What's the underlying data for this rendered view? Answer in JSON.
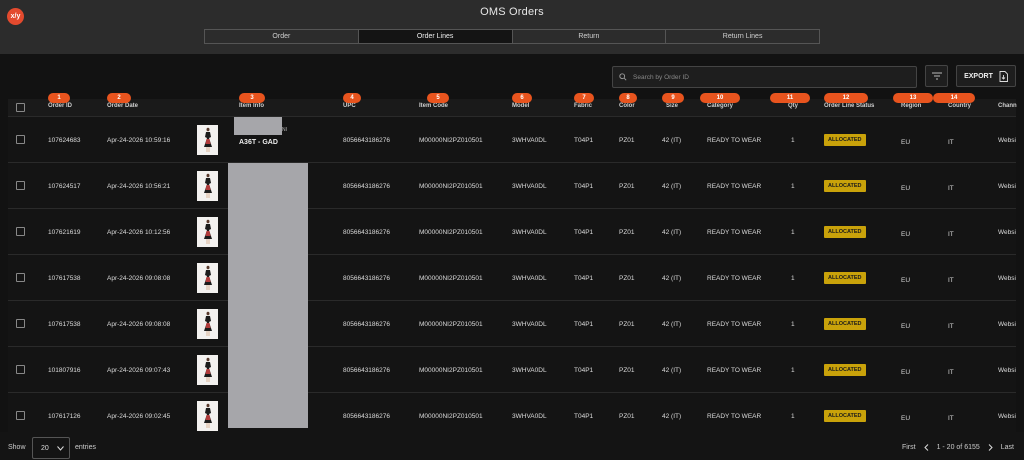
{
  "app": {
    "logo_text": "x/y",
    "title": "OMS Orders"
  },
  "tabs": [
    {
      "label": "Order",
      "active": false
    },
    {
      "label": "Order Lines",
      "active": true
    },
    {
      "label": "Return",
      "active": false
    },
    {
      "label": "Return Lines",
      "active": false
    }
  ],
  "toolbar": {
    "search_placeholder": "Search by Order ID",
    "search_icon": "search-icon",
    "filter_icon": "filter-icon",
    "export_label": "EXPORT",
    "export_icon": "file-export-icon"
  },
  "table": {
    "columns": [
      {
        "label": "Order ID",
        "marker": "1"
      },
      {
        "label": "Order Date",
        "marker": "2"
      },
      {
        "label": "Item Info",
        "marker": "3"
      },
      {
        "label": "UPC",
        "marker": "4"
      },
      {
        "label": "Item Code",
        "marker": "5"
      },
      {
        "label": "Model",
        "marker": "6"
      },
      {
        "label": "Fabric",
        "marker": "7"
      },
      {
        "label": "Color",
        "marker": "8"
      },
      {
        "label": "Size",
        "marker": "9"
      },
      {
        "label": "Category",
        "marker": "10"
      },
      {
        "label": "Qty",
        "marker": "11"
      },
      {
        "label": "Order Line Status",
        "marker": "12"
      },
      {
        "label": "Region",
        "marker": "13"
      },
      {
        "label": "Country",
        "marker": "14"
      },
      {
        "label": "Chann",
        "marker": ""
      }
    ],
    "first_row_item": {
      "tail": "NI",
      "label": "A36T - GAD"
    },
    "rows": [
      {
        "order_id": "107624683",
        "order_date": "Apr-24-2026 10:59:16",
        "upc": "8056643186276",
        "item_code": "M00000NI2PZ010501",
        "model": "3WHVA0DL",
        "fabric": "T04P1",
        "color": "PZ01",
        "size": "42 (IT)",
        "category": "READY TO WEAR",
        "qty": "1",
        "status": "ALLOCATED",
        "region": "EU",
        "country": "IT",
        "channel": "Websi"
      },
      {
        "order_id": "107624517",
        "order_date": "Apr-24-2026 10:56:21",
        "upc": "8056643186276",
        "item_code": "M00000NI2PZ010501",
        "model": "3WHVA0DL",
        "fabric": "T04P1",
        "color": "PZ01",
        "size": "42 (IT)",
        "category": "READY TO WEAR",
        "qty": "1",
        "status": "ALLOCATED",
        "region": "EU",
        "country": "IT",
        "channel": "Websi"
      },
      {
        "order_id": "107621619",
        "order_date": "Apr-24-2026 10:12:56",
        "upc": "8056643186276",
        "item_code": "M00000NI2PZ010501",
        "model": "3WHVA0DL",
        "fabric": "T04P1",
        "color": "PZ01",
        "size": "42 (IT)",
        "category": "READY TO WEAR",
        "qty": "1",
        "status": "ALLOCATED",
        "region": "EU",
        "country": "IT",
        "channel": "Websi"
      },
      {
        "order_id": "107617538",
        "order_date": "Apr-24-2026 09:08:08",
        "upc": "8056643186276",
        "item_code": "M00000NI2PZ010501",
        "model": "3WHVA0DL",
        "fabric": "T04P1",
        "color": "PZ01",
        "size": "42 (IT)",
        "category": "READY TO WEAR",
        "qty": "1",
        "status": "ALLOCATED",
        "region": "EU",
        "country": "IT",
        "channel": "Websi"
      },
      {
        "order_id": "107617538",
        "order_date": "Apr-24-2026 09:08:08",
        "upc": "8056643186276",
        "item_code": "M00000NI2PZ010501",
        "model": "3WHVA0DL",
        "fabric": "T04P1",
        "color": "PZ01",
        "size": "42 (IT)",
        "category": "READY TO WEAR",
        "qty": "1",
        "status": "ALLOCATED",
        "region": "EU",
        "country": "IT",
        "channel": "Websi"
      },
      {
        "order_id": "101807916",
        "order_date": "Apr-24-2026 09:07:43",
        "upc": "8056643186276",
        "item_code": "M00000NI2PZ010501",
        "model": "3WHVA0DL",
        "fabric": "T04P1",
        "color": "PZ01",
        "size": "42 (IT)",
        "category": "READY TO WEAR",
        "qty": "1",
        "status": "ALLOCATED",
        "region": "EU",
        "country": "IT",
        "channel": "Websi"
      },
      {
        "order_id": "107617126",
        "order_date": "Apr-24-2026 09:02:45",
        "upc": "8056643186276",
        "item_code": "M00000NI2PZ010501",
        "model": "3WHVA0DL",
        "fabric": "T04P1",
        "color": "PZ01",
        "size": "42 (IT)",
        "category": "READY TO WEAR",
        "qty": "1",
        "status": "ALLOCATED",
        "region": "EU",
        "country": "IT",
        "channel": "Websi"
      }
    ]
  },
  "footer": {
    "show_label": "Show",
    "page_size": "20",
    "entries_label": "entries",
    "first_label": "First",
    "range_label": "1 - 20 of 6155",
    "last_label": "Last"
  },
  "colors": {
    "accent_marker": "#e8541e",
    "status_allocated": "#c9a20a",
    "background": "#121212"
  }
}
